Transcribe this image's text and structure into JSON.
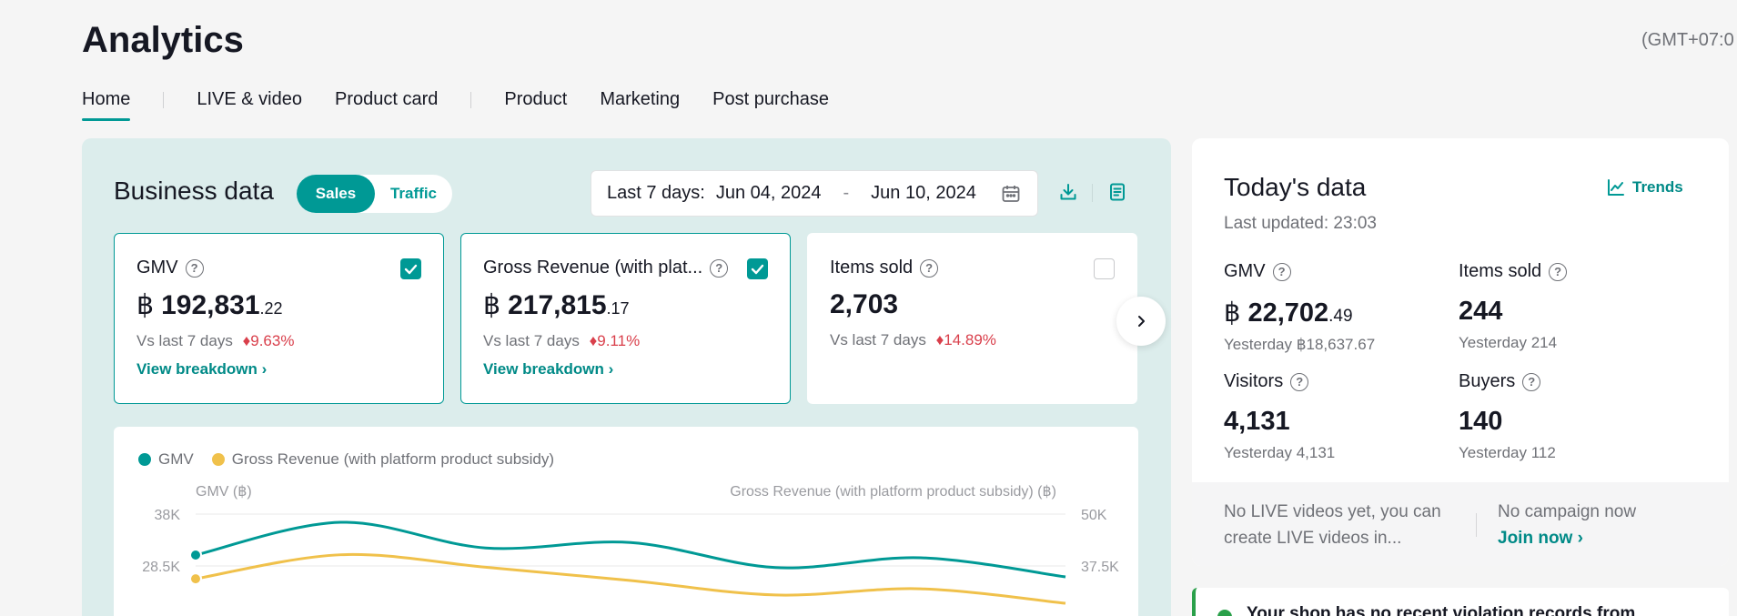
{
  "header": {
    "title": "Analytics",
    "timezone": "(GMT+07:0"
  },
  "tabs": [
    {
      "label": "Home",
      "active": true
    },
    {
      "label": "LIVE & video",
      "active": false
    },
    {
      "label": "Product card",
      "active": false
    },
    {
      "label": "Product",
      "active": false
    },
    {
      "label": "Marketing",
      "active": false
    },
    {
      "label": "Post purchase",
      "active": false
    }
  ],
  "business": {
    "title": "Business data",
    "toggle": {
      "sales": "Sales",
      "traffic": "Traffic",
      "selected": "Sales"
    },
    "date_range": {
      "label": "Last 7 days:",
      "start": "Jun 04, 2024",
      "separator": "-",
      "end": "Jun 10, 2024"
    },
    "metrics": [
      {
        "label": "GMV",
        "checked": true,
        "currency": "฿",
        "value_int": "192,831",
        "value_dec": ".22",
        "compare_label": "Vs last 7 days",
        "change": "9.63%",
        "change_dir": "down",
        "link": "View breakdown ›"
      },
      {
        "label": "Gross Revenue (with plat...",
        "checked": true,
        "currency": "฿",
        "value_int": "217,815",
        "value_dec": ".17",
        "compare_label": "Vs last 7 days",
        "change": "9.11%",
        "change_dir": "down",
        "link": "View breakdown ›"
      },
      {
        "label": "Items sold",
        "checked": false,
        "currency": "",
        "value_int": "2,703",
        "value_dec": "",
        "compare_label": "Vs last 7 days",
        "change": "14.89%",
        "change_dir": "down",
        "link": ""
      }
    ],
    "change_arrow": "♦"
  },
  "chart_data": {
    "type": "line",
    "series": [
      {
        "name": "GMV",
        "color": "#009995",
        "axis": "left",
        "values": [
          30500,
          36500,
          31800,
          32800,
          28200,
          30000,
          26500
        ]
      },
      {
        "name": "Gross Revenue (with platform product subsidy)",
        "color": "#f0c14b",
        "axis": "right",
        "values": [
          34400,
          40200,
          37200,
          34000,
          30500,
          32000,
          28500
        ]
      }
    ],
    "ylabel_left": "GMV (฿)",
    "ylabel_right": "Gross Revenue (with platform product subsidy) (฿)",
    "y_left_ticks": [
      "38K",
      "28.5K"
    ],
    "y_right_ticks": [
      "50K",
      "37.5K"
    ],
    "ylim_left": [
      9500,
      38000
    ],
    "ylim_right": [
      12500,
      50000
    ],
    "legend_position": "top-left",
    "grid": true
  },
  "today": {
    "title": "Today's data",
    "last_updated": "Last updated: 23:03",
    "trends_label": "Trends",
    "metrics": [
      {
        "label": "GMV",
        "currency": "฿",
        "value_int": "22,702",
        "value_dec": ".49",
        "yesterday": "Yesterday ฿18,637.67"
      },
      {
        "label": "Items sold",
        "currency": "",
        "value_int": "244",
        "value_dec": "",
        "yesterday": "Yesterday 214"
      },
      {
        "label": "Visitors",
        "currency": "",
        "value_int": "4,131",
        "value_dec": "",
        "yesterday": "Yesterday 4,131"
      },
      {
        "label": "Buyers",
        "currency": "",
        "value_int": "140",
        "value_dec": "",
        "yesterday": "Yesterday 112"
      }
    ],
    "live_note": "No LIVE videos yet, you can create LIVE videos in...",
    "campaign_note": "No campaign now",
    "join_label": "Join now ›"
  },
  "violation": {
    "text": "Your shop has no recent violation records from"
  },
  "colors": {
    "accent": "#009995",
    "gross": "#f0c14b",
    "down": "#d93f4b"
  }
}
